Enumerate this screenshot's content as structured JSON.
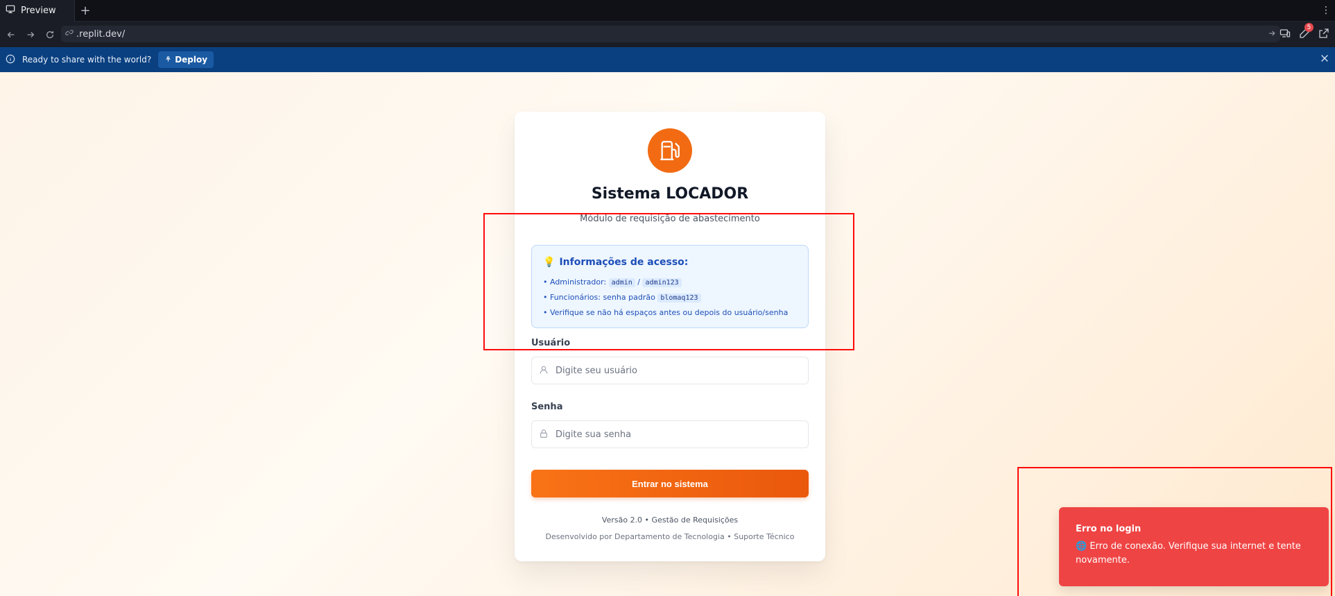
{
  "browser": {
    "tab_label": "Preview",
    "new_tab": "+",
    "url": ".replit.dev/",
    "notification_count": "5",
    "deploy_prompt": "Ready to share with the world?",
    "deploy_label": "Deploy"
  },
  "login": {
    "title": "Sistema LOCADOR",
    "subtitle": "Módulo de requisição de abastecimento",
    "info": {
      "heading": "Informações de acesso:",
      "admin_prefix": "• Administrador:",
      "admin_user": "admin",
      "separator": "/",
      "admin_pass": "admin123",
      "staff_prefix": "• Funcionários: senha padrão",
      "staff_pass": "blomaq123",
      "tip": "• Verifique se não há espaços antes ou depois do usuário/senha"
    },
    "user_label": "Usuário",
    "user_placeholder": "Digite seu usuário",
    "pass_label": "Senha",
    "pass_placeholder": "Digite sua senha",
    "submit_label": "Entrar no sistema",
    "footer_version": "Versão 2.0 • Gestão de Requisições",
    "footer_dev": "Desenvolvido por Departamento de Tecnologia • Suporte Técnico"
  },
  "toast": {
    "title": "Erro no login",
    "message": "🌐 Erro de conexão. Verifique sua internet e tente novamente."
  },
  "colors": {
    "accent": "#f97316",
    "error": "#ef4444",
    "info_text": "#1d4fb8",
    "highlight": "#ff0a0a"
  }
}
